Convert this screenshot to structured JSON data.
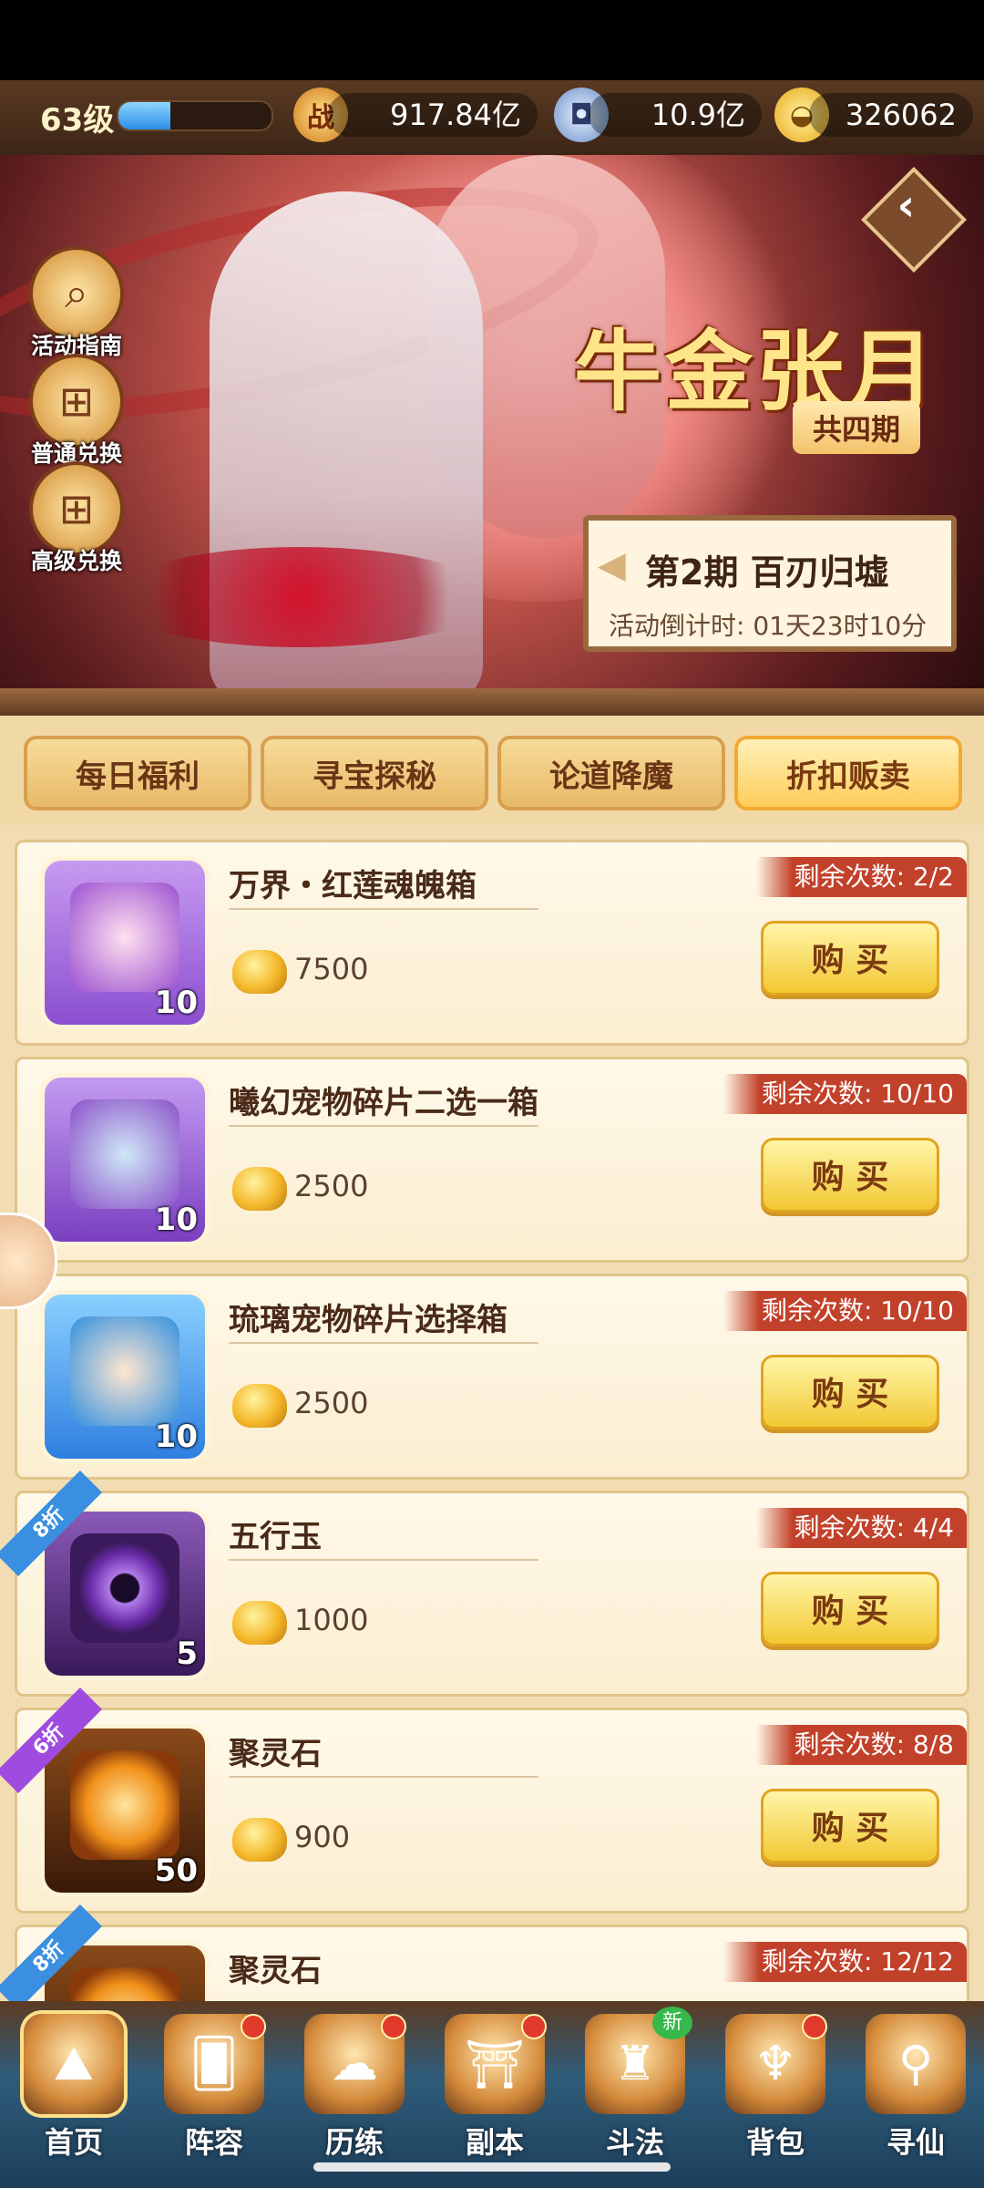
{
  "player": {
    "level": "63级",
    "exp_fraction": 0.34,
    "battle_power_icon_text": "战",
    "battle_power": "917.84亿",
    "silver": "10.9亿",
    "gold": "326062"
  },
  "banner": {
    "event_title": "牛金张月",
    "event_subtitle": "共四期",
    "period_title": "第2期  百刃归墟",
    "countdown": "活动倒计时: 01天23时10分",
    "side_buttons": [
      {
        "label": "活动指南",
        "icon": "magnifier-icon"
      },
      {
        "label": "普通兑换",
        "icon": "gift-box-icon"
      },
      {
        "label": "高级兑换",
        "icon": "gift-box-icon"
      }
    ]
  },
  "tabs": [
    {
      "label": "每日福利",
      "active": false
    },
    {
      "label": "寻宝探秘",
      "active": false
    },
    {
      "label": "论道降魔",
      "active": false
    },
    {
      "label": "折扣贩卖",
      "active": true
    }
  ],
  "buy_label": "购 买",
  "items": [
    {
      "name": "万界・红莲魂魄箱",
      "count": "10",
      "price": "7500",
      "remaining": "剩余次数: 2/2",
      "discount": "",
      "icon_color": "#9a4fd0"
    },
    {
      "name": "曦幻宠物碎片二选一箱",
      "count": "10",
      "price": "2500",
      "remaining": "剩余次数: 10/10",
      "discount": "",
      "icon_color": "#8a4fc8"
    },
    {
      "name": "琉璃宠物碎片选择箱",
      "count": "10",
      "price": "2500",
      "remaining": "剩余次数: 10/10",
      "discount": "",
      "icon_color": "#2f8fe0"
    },
    {
      "name": "五行玉",
      "count": "5",
      "price": "1000",
      "remaining": "剩余次数: 4/4",
      "discount": "8折",
      "icon_color": "#5a2a7a"
    },
    {
      "name": "聚灵石",
      "count": "50",
      "price": "900",
      "remaining": "剩余次数: 8/8",
      "discount": "6折",
      "icon_color": "#7a3a14"
    },
    {
      "name": "聚灵石",
      "count": "",
      "price": "",
      "remaining": "剩余次数: 12/12",
      "discount": "8折",
      "icon_color": "#7a3a14"
    }
  ],
  "nav": [
    {
      "label": "首页",
      "icon": "home-icon",
      "active": true,
      "dot": false,
      "new": false
    },
    {
      "label": "阵容",
      "icon": "cards-icon",
      "active": false,
      "dot": true,
      "new": false
    },
    {
      "label": "历练",
      "icon": "dragon-icon",
      "active": false,
      "dot": true,
      "new": false
    },
    {
      "label": "副本",
      "icon": "gate-icon",
      "active": false,
      "dot": true,
      "new": false
    },
    {
      "label": "斗法",
      "icon": "tower-icon",
      "active": false,
      "dot": false,
      "new": true,
      "new_text": "新"
    },
    {
      "label": "背包",
      "icon": "bag-icon",
      "active": false,
      "dot": true,
      "new": false
    },
    {
      "label": "寻仙",
      "icon": "scroll-icon",
      "active": false,
      "dot": false,
      "new": false
    }
  ],
  "colors": {
    "accent": "#f2c832",
    "ribbon_red": "#c2412a",
    "discount_blue": "#3a8fe0",
    "discount_purple": "#a04be0"
  }
}
